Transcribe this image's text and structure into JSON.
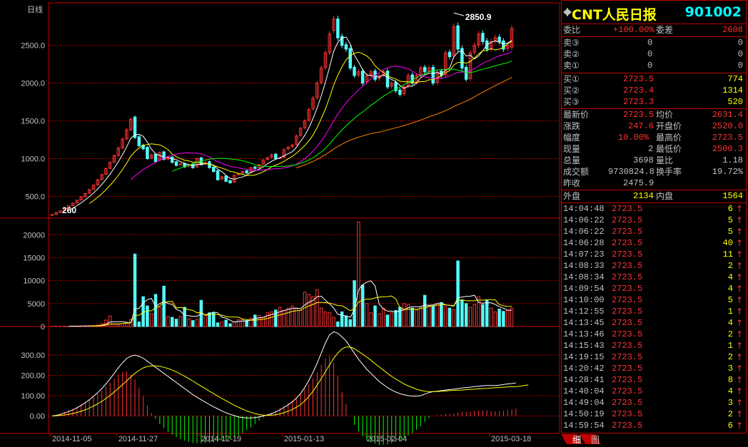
{
  "chart_title": "日线",
  "stock": {
    "name": "CNT人民日报",
    "code": "901002"
  },
  "colors": {
    "up": "#ff3232",
    "down": "#54fcfc",
    "grid": "#c00000",
    "ma5": "#ffffff",
    "ma10": "#ffff00",
    "ma20": "#ff00ff",
    "ma30": "#00ff00",
    "ma60": "#ff8000"
  },
  "price_axis": {
    "ticks": [
      "2500.0",
      "2000.0",
      "1500.0",
      "1000.0",
      "500.0"
    ],
    "vals": [
      2500,
      2000,
      1500,
      1000,
      500
    ],
    "min": 250,
    "max": 2950
  },
  "volume_axis": {
    "ticks": [
      "20000",
      "15000",
      "10000",
      "5000",
      "0"
    ],
    "vals": [
      20000,
      15000,
      10000,
      5000,
      0
    ],
    "max": 23000
  },
  "macd_axis": {
    "ticks": [
      "300.00",
      "200.00",
      "100.00",
      "0.00"
    ],
    "vals": [
      300,
      200,
      100,
      0
    ],
    "min": -30,
    "max": 420
  },
  "date_labels": [
    "2014-11-05",
    "2014-11-27",
    "2014-12-19",
    "2015-01-13",
    "2015-02-04",
    "2015-03-18"
  ],
  "date_label_index": [
    0,
    16,
    36,
    56,
    76,
    106
  ],
  "markers": {
    "low": "260",
    "high": "2850.9"
  },
  "closes": [
    260,
    285,
    310,
    340,
    375,
    410,
    450,
    495,
    540,
    590,
    650,
    720,
    790,
    870,
    950,
    1040,
    1140,
    1260,
    1380,
    1520,
    1280,
    1170,
    1130,
    1000,
    1050,
    960,
    1080,
    990,
    1010,
    950,
    910,
    930,
    890,
    920,
    880,
    1000,
    920,
    950,
    880,
    830,
    720,
    760,
    700,
    680,
    780,
    800,
    830,
    810,
    880,
    870,
    920,
    980,
    1010,
    1050,
    1000,
    1010,
    1120,
    1150,
    1180,
    1300,
    1400,
    1500,
    1650,
    1800,
    2000,
    2200,
    2400,
    2650,
    2850,
    2600,
    2500,
    2450,
    2200,
    2100,
    2150,
    2000,
    2100,
    2150,
    2050,
    2100,
    2150,
    1950,
    2000,
    1900,
    1850,
    1950,
    2100,
    2000,
    2100,
    2200,
    2150,
    2200,
    2000,
    2150,
    2100,
    2400,
    2350,
    2750,
    2450,
    2200,
    2050,
    2400,
    2500,
    2650,
    2550,
    2450,
    2550,
    2600,
    2550,
    2450,
    2500,
    2723.5
  ],
  "opens": [
    250,
    262,
    287,
    312,
    342,
    378,
    412,
    452,
    498,
    543,
    592,
    652,
    723,
    793,
    873,
    953,
    1043,
    1143,
    1263,
    1383,
    1550,
    1290,
    1180,
    1150,
    1010,
    1060,
    980,
    1090,
    995,
    1020,
    960,
    920,
    935,
    900,
    930,
    890,
    1010,
    930,
    960,
    890,
    840,
    730,
    770,
    710,
    690,
    790,
    810,
    840,
    815,
    890,
    880,
    930,
    990,
    1020,
    1060,
    1010,
    1020,
    1130,
    1160,
    1190,
    1310,
    1410,
    1510,
    1660,
    1810,
    2010,
    2210,
    2410,
    2700,
    2850,
    2620,
    2510,
    2460,
    2210,
    2110,
    2160,
    2020,
    2110,
    2160,
    2060,
    2110,
    2160,
    1960,
    2010,
    1910,
    1860,
    1960,
    2110,
    2010,
    2110,
    2210,
    2160,
    2210,
    2010,
    2160,
    2110,
    2410,
    2360,
    2760,
    2460,
    2210,
    2060,
    2410,
    2510,
    2660,
    2560,
    2460,
    2560,
    2610,
    2560,
    2460,
    2475.9
  ],
  "volumes": [
    40,
    60,
    50,
    80,
    70,
    90,
    100,
    110,
    150,
    130,
    200,
    300,
    600,
    1400,
    2300,
    500,
    400,
    600,
    800,
    1500,
    15800,
    1000,
    6500,
    4500,
    2800,
    7000,
    4200,
    8800,
    2200,
    2000,
    1600,
    2200,
    4200,
    1700,
    1300,
    1600,
    5700,
    2400,
    3000,
    3000,
    800,
    1000,
    1400,
    600,
    1000,
    1500,
    1500,
    1300,
    1800,
    2500,
    2400,
    2000,
    3000,
    3200,
    3600,
    4200,
    3500,
    4000,
    4500,
    3900,
    3500,
    7500,
    7000,
    6500,
    8000,
    4000,
    3200,
    3000,
    2000,
    1000,
    3200,
    2300,
    1500,
    10000,
    22800,
    9000,
    5000,
    3000,
    4500,
    2800,
    4000,
    2500,
    3000,
    3500,
    4200,
    5000,
    4800,
    4000,
    3600,
    4200,
    6800,
    4500,
    4500,
    5000,
    5200,
    4300,
    4000,
    3700,
    14300,
    5800,
    5000,
    4200,
    4800,
    6500,
    4800,
    5700,
    4000,
    3200,
    3800,
    3300,
    3500,
    4000
  ],
  "macd_dif": [
    0,
    3,
    8,
    15,
    22,
    30,
    40,
    52,
    65,
    80,
    97,
    115,
    135,
    158,
    183,
    210,
    238,
    262,
    283,
    295,
    300,
    295,
    285,
    270,
    255,
    240,
    225,
    210,
    195,
    180,
    165,
    150,
    135,
    120,
    105,
    92,
    80,
    68,
    56,
    45,
    35,
    25,
    16,
    8,
    2,
    -5,
    -8,
    -10,
    -10,
    -8,
    -5,
    0,
    5,
    12,
    20,
    30,
    42,
    55,
    70,
    88,
    110,
    140,
    175,
    215,
    260,
    310,
    360,
    400,
    415,
    408,
    390,
    370,
    340,
    310,
    280,
    255,
    230,
    210,
    190,
    170,
    155,
    140,
    128,
    118,
    110,
    105,
    100,
    98,
    98,
    100,
    108,
    115,
    120,
    122,
    125,
    128,
    130,
    132,
    135,
    138,
    140,
    142,
    145,
    147,
    149,
    150,
    150,
    150,
    152,
    155,
    158,
    160,
    163
  ],
  "macd_dea": [
    0,
    1,
    3,
    5,
    8,
    12,
    17,
    23,
    30,
    39,
    49,
    60,
    72,
    86,
    101,
    118,
    136,
    154,
    173,
    192,
    210,
    225,
    237,
    244,
    247,
    247,
    245,
    240,
    234,
    226,
    217,
    207,
    196,
    184,
    172,
    159,
    147,
    135,
    122,
    110,
    98,
    86,
    75,
    64,
    53,
    43,
    34,
    25,
    18,
    12,
    7,
    4,
    3,
    4,
    6,
    10,
    16,
    23,
    32,
    43,
    56,
    74,
    96,
    122,
    152,
    184,
    218,
    252,
    284,
    310,
    330,
    340,
    340,
    332,
    318,
    305,
    290,
    275,
    258,
    242,
    226,
    210,
    195,
    182,
    170,
    158,
    148,
    140,
    132,
    126,
    122,
    120,
    120,
    120,
    122,
    123,
    125,
    126,
    127,
    128,
    130,
    131,
    132,
    134,
    135,
    136,
    138,
    139,
    140,
    142,
    143,
    144,
    145,
    147,
    150,
    153
  ]
}
